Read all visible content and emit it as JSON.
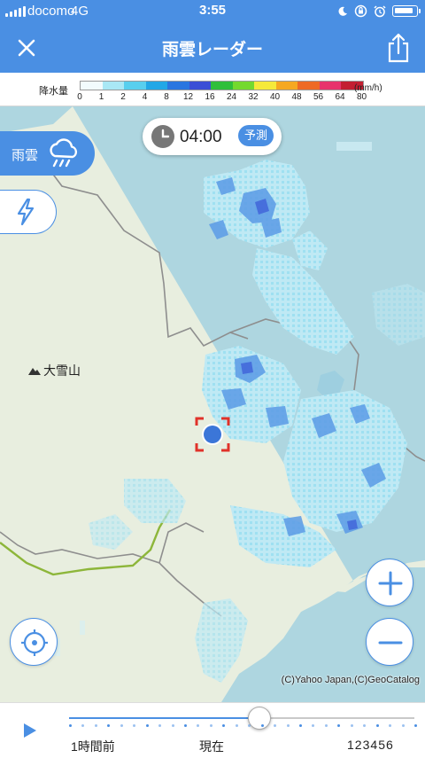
{
  "status_bar": {
    "carrier": "docomo",
    "network": "4G",
    "time": "3:55"
  },
  "header": {
    "title": "雨雲レーダー",
    "close_icon": "close-icon",
    "share_icon": "share-icon"
  },
  "legend": {
    "label": "降水量",
    "unit": "(mm/h)",
    "ticks": [
      "0",
      "1",
      "2",
      "4",
      "8",
      "12",
      "16",
      "24",
      "32",
      "40",
      "48",
      "56",
      "64",
      "80"
    ],
    "colors": [
      "#f2fbfd",
      "#a9e8f5",
      "#58cfee",
      "#22a7e6",
      "#2a76e0",
      "#3b4fd6",
      "#2fbf3a",
      "#74d92e",
      "#f6e93a",
      "#f6a821",
      "#ee6a25",
      "#e8336c",
      "#c31f31"
    ]
  },
  "map": {
    "time_display": "04:00",
    "time_badge": "予測",
    "layers": {
      "rain_label": "雨雲",
      "rain_icon": "rain-cloud-icon",
      "thunder_icon": "lightning-icon"
    },
    "place_label": "大雪山",
    "credit": "(C)Yahoo Japan,(C)GeoCatalog",
    "accent": "#4a8fe3"
  },
  "timeline": {
    "left_label": "1時間前",
    "now_label": "現在",
    "hour_labels": [
      "1",
      "2",
      "3",
      "4",
      "5",
      "6"
    ],
    "position_fraction": 0.55
  }
}
